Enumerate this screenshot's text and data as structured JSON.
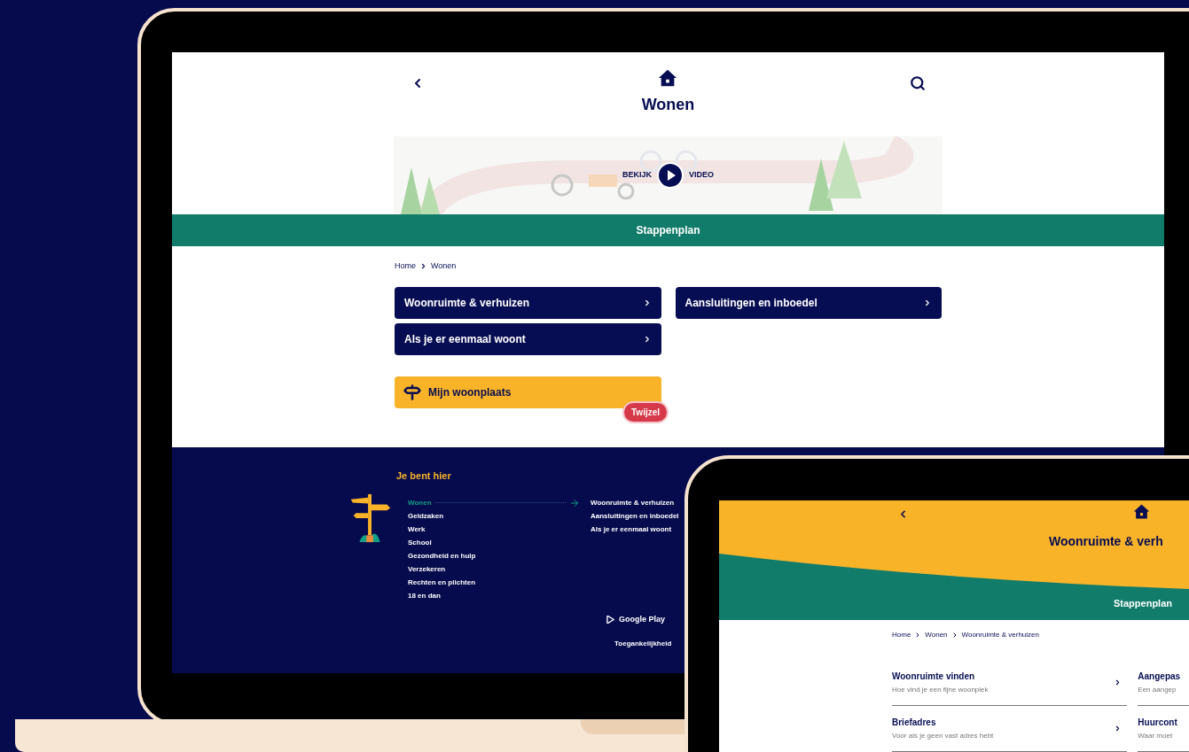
{
  "laptop": {
    "header": {
      "title": "Wonen"
    },
    "video": {
      "left_label": "BEKIJK",
      "right_label": "VIDEO"
    },
    "section_bar": "Stappenplan",
    "breadcrumb": [
      "Home",
      "Wonen"
    ],
    "topic_buttons": [
      "Woonruimte & verhuizen",
      "Aansluitingen en inboedel",
      "Als je er eenmaal woont"
    ],
    "location_button": {
      "label": "Mijn woonplaats",
      "badge": "Twijzel"
    },
    "footer": {
      "heading": "Je bent hier",
      "topics": [
        {
          "label": "Wonen",
          "selected": true
        },
        {
          "label": "Geldzaken",
          "selected": false
        },
        {
          "label": "Werk",
          "selected": false
        },
        {
          "label": "School",
          "selected": false
        },
        {
          "label": "Gezondheid en hulp",
          "selected": false
        },
        {
          "label": "Verzekeren",
          "selected": false
        },
        {
          "label": "Rechten en plichten",
          "selected": false
        },
        {
          "label": "18 en dan",
          "selected": false
        }
      ],
      "subtopics": [
        "Woonruimte & verhuizen",
        "Aansluitingen en inboedel",
        "Als je er eenmaal woont"
      ],
      "store_link": "Google Play",
      "accessibility_link": "Toegankelijkheid"
    }
  },
  "tablet": {
    "title": "Woonruimte & verh",
    "section_bar": "Stappenplan",
    "breadcrumb": [
      "Home",
      "Wonen",
      "Woonruimte & verhuizen"
    ],
    "columns": [
      [
        {
          "title": "Woonruimte vinden",
          "subtitle": "Hoe vind je een fijne woonplek"
        },
        {
          "title": "Briefadres",
          "subtitle": "Voor als je geen vast adres hebt"
        }
      ],
      [
        {
          "title": "Aangepas",
          "subtitle": "Een aangep"
        },
        {
          "title": "Huurcont",
          "subtitle": "Waar moet"
        }
      ]
    ]
  }
}
